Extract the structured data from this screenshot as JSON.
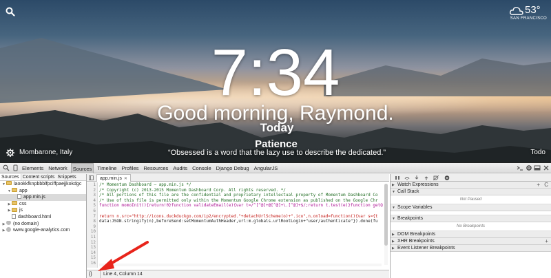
{
  "dashboard": {
    "clock": "7:34",
    "greeting": "Good morning, Raymond.",
    "today_label": "Today",
    "focus": "Patience",
    "quote": "“Obsessed is a word that the lazy use to describe the dedicated.”",
    "location": "Mombarone, Italy",
    "todo_label": "Todo",
    "weather": {
      "temperature": "53°",
      "city": "SAN FRANCISCO",
      "icon": "cloud-icon"
    }
  },
  "devtools": {
    "tabs": [
      "Elements",
      "Network",
      "Sources",
      "Timeline",
      "Profiles",
      "Resources",
      "Audits",
      "Console",
      "Django Debug",
      "AngularJS"
    ],
    "active_tab": "Sources",
    "navigator": {
      "tabs": [
        "Sources",
        "Content scripts",
        "Snippets"
      ],
      "tree": [
        {
          "label": "laookkfknpbbblfpciffpaejjkokdgc",
          "type": "folder",
          "depth": 0,
          "expanded": true
        },
        {
          "label": "app",
          "type": "folder",
          "depth": 1,
          "expanded": true
        },
        {
          "label": "app.min.js",
          "type": "file",
          "depth": 2,
          "selected": true
        },
        {
          "label": "css",
          "type": "folder",
          "depth": 1,
          "expanded": false
        },
        {
          "label": "js",
          "type": "folder",
          "depth": 1,
          "expanded": false
        },
        {
          "label": "dashboard.html",
          "type": "file",
          "depth": 1
        },
        {
          "label": "(no domain)",
          "type": "globe",
          "depth": 0,
          "expanded": false
        },
        {
          "label": "www.google-analytics.com",
          "type": "globe",
          "depth": 0,
          "expanded": false
        }
      ]
    },
    "editor": {
      "open_file": "app.min.js",
      "line_numbers": [
        "1",
        "2",
        "3",
        "4",
        "5",
        "6",
        "7",
        "8",
        "9",
        "10",
        "11",
        "12",
        "13",
        "14",
        "15",
        "16"
      ],
      "lines": [
        {
          "cls": "cm",
          "text": "/* Momentum Dashboard – app.min.js */"
        },
        {
          "cls": "cm",
          "text": "/* Copyright (c) 2013-2015 Momentum Dashboard Corp. All rights reserved. */"
        },
        {
          "cls": "cm",
          "text": "/* All portions of this file are the confidential and proprietary intellectual property of Momentum Dashboard Co"
        },
        {
          "cls": "cm",
          "text": "/* Use of this file is permitted only within the Momentum Google Chrome extension as published on the Google Chr"
        },
        {
          "cls": "kw",
          "text": "function momoInit(){return!0}function validateEmail(e){var t=/^[^@]+@[^@]+\\.[^@]+$/;return t.test(e)}function getQ"
        },
        {
          "cls": "",
          "text": ""
        },
        {
          "cls": "str",
          "text": "return n.src=\"http://icons.duckduckgo.com/ip2/encrypted.\"+detachUrlScheme(o)+\".ico\",n.onload=function(){var s={t"
        },
        {
          "cls": "",
          "text": "data:JSON.stringify(n),beforeSend:setMomentumAuthHeader,url:m.globals.urlRootLogin+\"user/authenticate\"}).done(fu"
        }
      ],
      "status": {
        "format_button": "{}",
        "cursor_position": "Line 4, Column 14"
      }
    },
    "sidebar": {
      "panes": [
        {
          "title": "Watch Expressions",
          "expanded": false,
          "buttons": [
            "+",
            "C"
          ]
        },
        {
          "title": "Call Stack",
          "expanded": true,
          "body": "Not Paused"
        },
        {
          "title": "Scope Variables",
          "expanded": true,
          "body": ""
        },
        {
          "title": "Breakpoints",
          "expanded": true,
          "body": "No Breakpoints"
        },
        {
          "title": "DOM Breakpoints",
          "expanded": false
        },
        {
          "title": "XHR Breakpoints",
          "expanded": false,
          "buttons": [
            "+"
          ]
        },
        {
          "title": "Event Listener Breakpoints",
          "expanded": false
        }
      ]
    }
  }
}
